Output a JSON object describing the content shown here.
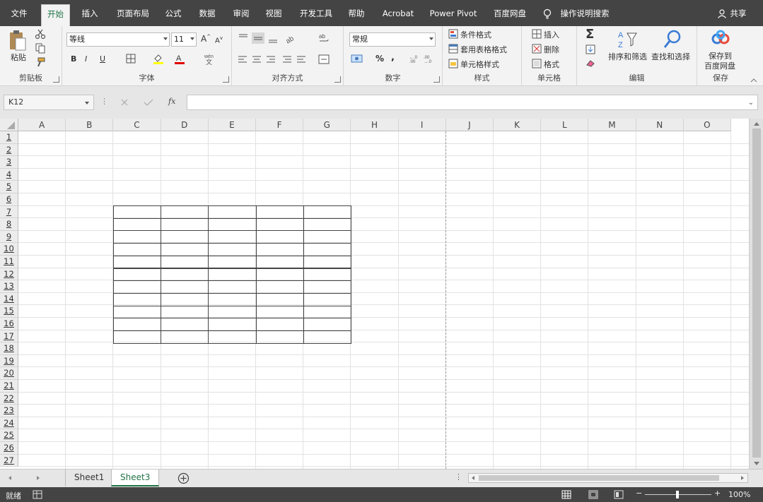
{
  "menu": {
    "tabs": [
      "文件",
      "开始",
      "插入",
      "页面布局",
      "公式",
      "数据",
      "审阅",
      "视图",
      "开发工具",
      "帮助",
      "Acrobat",
      "Power Pivot",
      "百度网盘"
    ],
    "active_tab": "开始",
    "search_label": "操作说明搜索",
    "share_label": "共享"
  },
  "ribbon": {
    "clipboard": {
      "paste": "粘贴",
      "label": "剪贴板"
    },
    "font": {
      "font_name": "等线",
      "font_size": "11",
      "bold": "B",
      "italic": "I",
      "underline": "U",
      "label": "字体"
    },
    "alignment": {
      "label": "对齐方式"
    },
    "number": {
      "format": "常规",
      "percent": "%",
      "comma": ",",
      "label": "数字"
    },
    "styles": {
      "conditional": "条件格式",
      "table_format": "套用表格格式",
      "cell_styles": "单元格样式",
      "label": "样式"
    },
    "cells": {
      "insert": "插入",
      "delete": "删除",
      "format": "格式",
      "label": "单元格"
    },
    "editing": {
      "sort_filter": "排序和筛选",
      "find_select": "查找和选择",
      "label": "编辑"
    },
    "save": {
      "save_to_line1": "保存到",
      "save_to_line2": "百度网盘",
      "label": "保存"
    }
  },
  "formula_bar": {
    "name_box": "K12",
    "fx": "fx",
    "value": ""
  },
  "grid": {
    "columns": [
      "A",
      "B",
      "C",
      "D",
      "E",
      "F",
      "G",
      "H",
      "I",
      "J",
      "K",
      "L",
      "M",
      "N",
      "O"
    ],
    "rows": [
      "1",
      "2",
      "3",
      "4",
      "5",
      "6",
      "7",
      "8",
      "9",
      "10",
      "11",
      "12",
      "13",
      "14",
      "15",
      "16",
      "17",
      "18",
      "19",
      "20",
      "21",
      "22",
      "23",
      "24",
      "25",
      "26",
      "27"
    ]
  },
  "sheets": {
    "tabs": [
      "Sheet1",
      "Sheet3"
    ],
    "active": "Sheet3"
  },
  "status": {
    "ready": "就绪",
    "zoom": "100%"
  },
  "colors": {
    "accent": "#217346",
    "menubar": "#444444",
    "ribbon": "#f3f3f3"
  }
}
